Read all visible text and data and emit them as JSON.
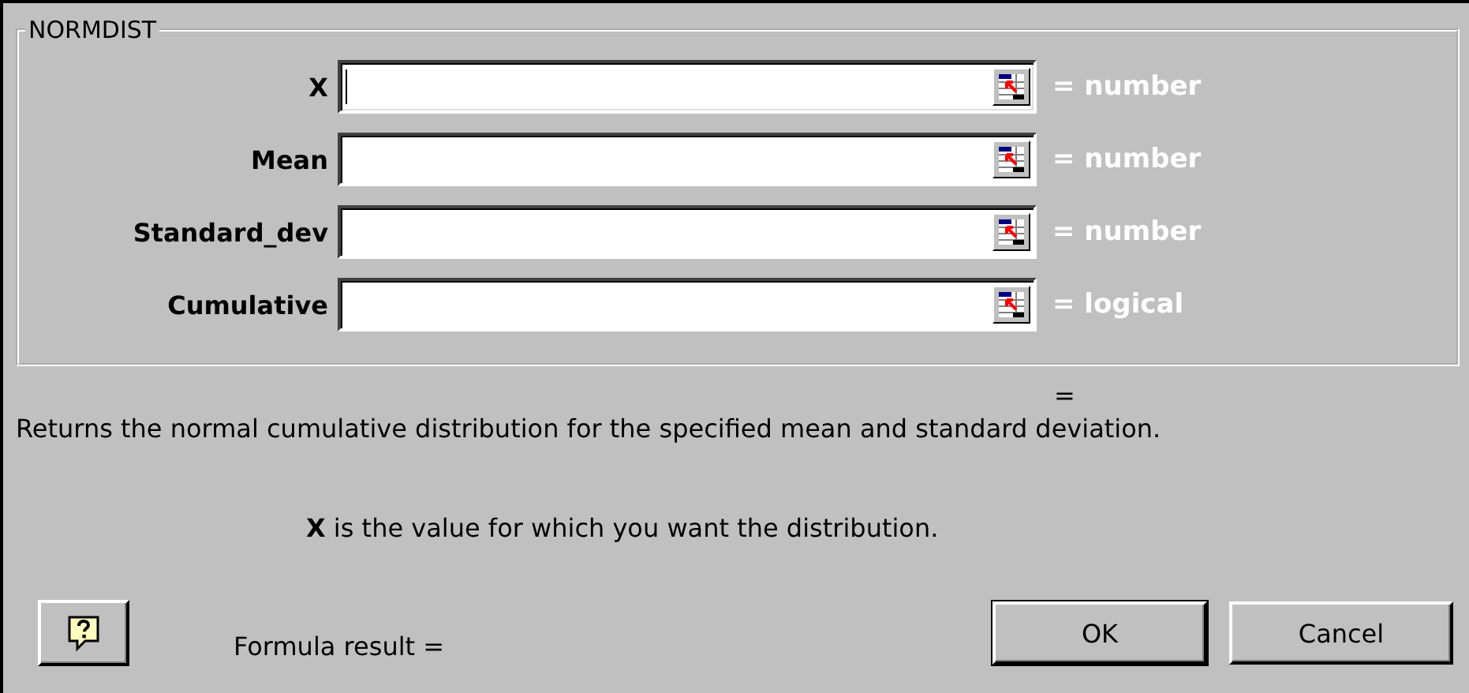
{
  "group": {
    "title": "NORMDIST"
  },
  "arguments": [
    {
      "label": "X",
      "focused": true,
      "result": "= number"
    },
    {
      "label": "Mean",
      "focused": false,
      "result": "= number"
    },
    {
      "label": "Standard_dev",
      "focused": false,
      "result": "= number"
    },
    {
      "label": "Cumulative",
      "focused": false,
      "result": "= logical"
    }
  ],
  "function_result": "=",
  "description": "Returns the normal cumulative distribution for the specified mean and standard deviation.",
  "argument_help": "**X** is the value for which you want the distribution.",
  "formula_result": "Formula result =",
  "buttons": [
    "OK",
    "Cancel"
  ]
}
